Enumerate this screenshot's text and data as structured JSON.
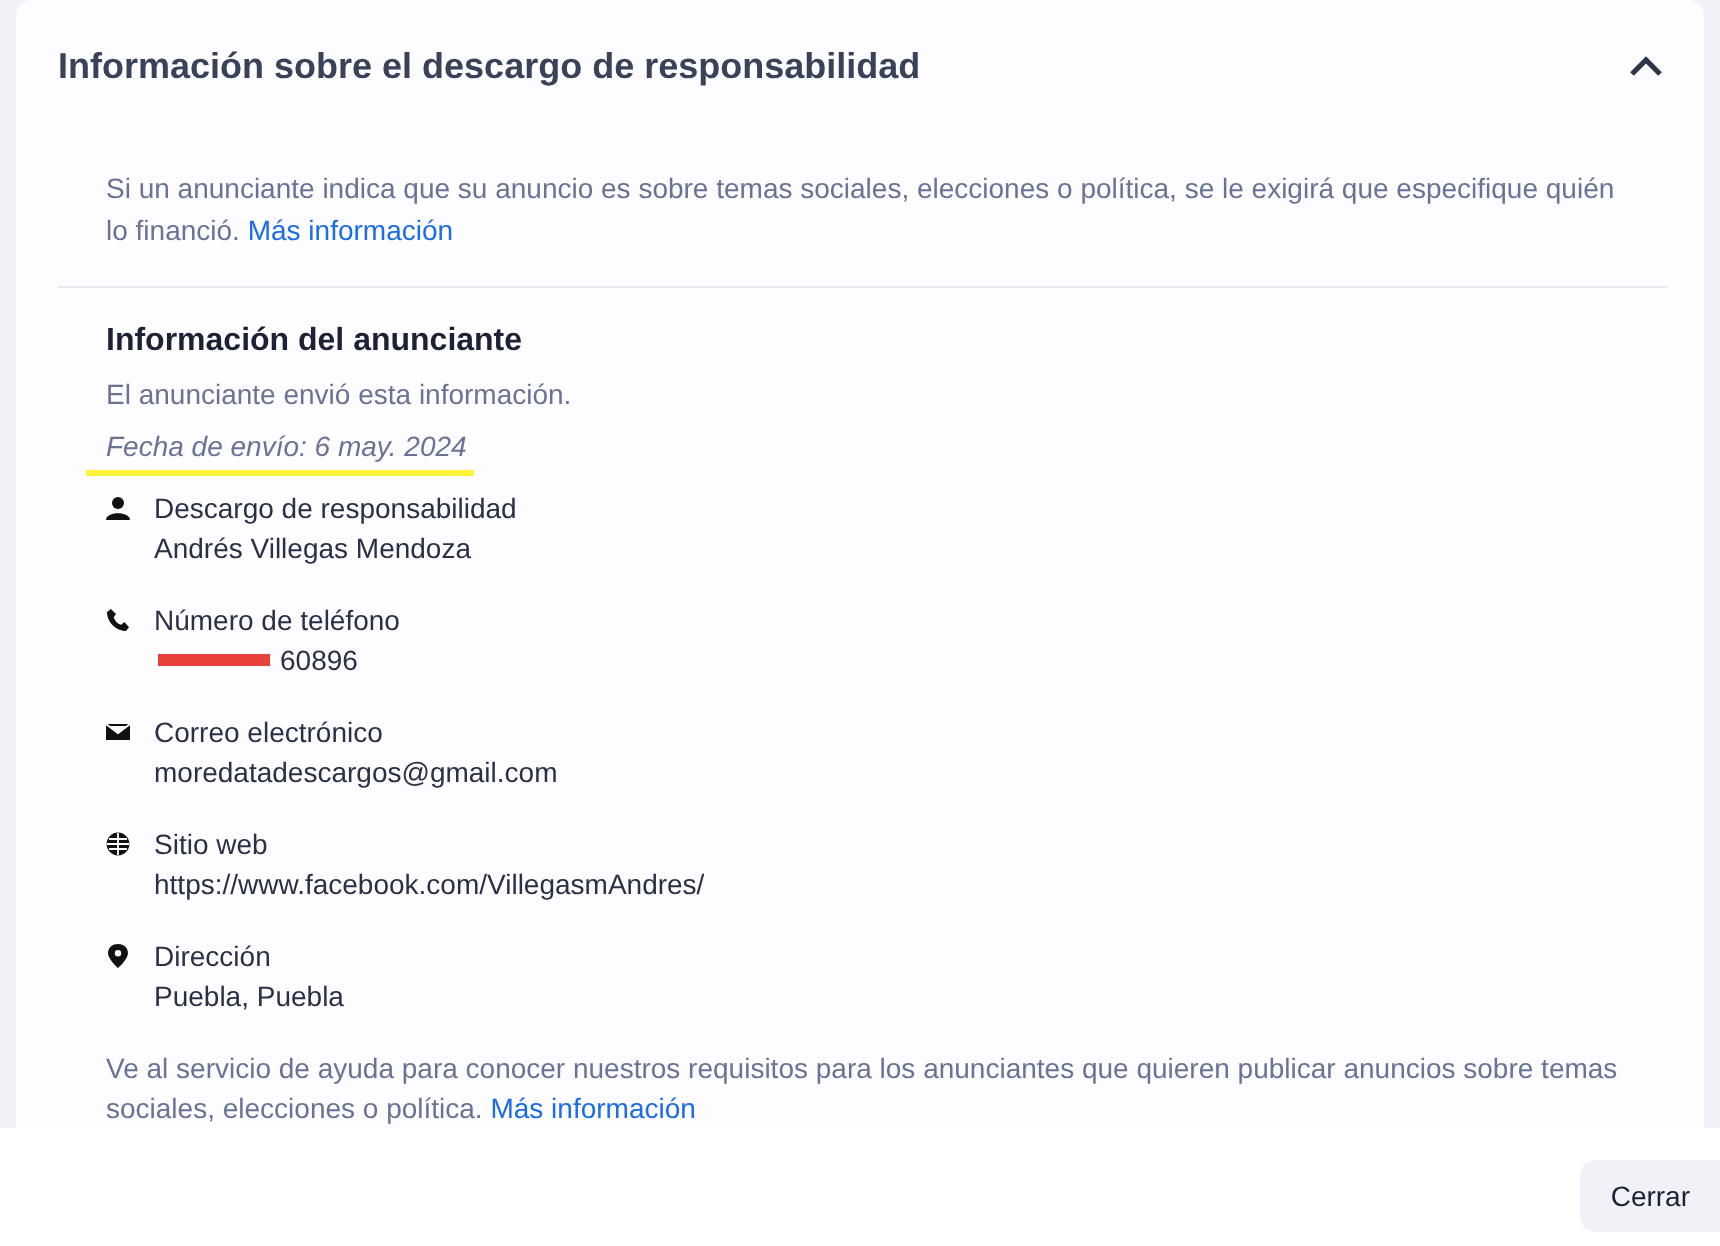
{
  "section": {
    "title": "Información sobre el descargo de responsabilidad",
    "expanded": true,
    "intro": "Si un anunciante indica que su anuncio es sobre temas sociales, elecciones o política, se le exigirá que especifique quién lo financió.",
    "intro_link": "Más información",
    "advertiser": {
      "heading": "Información del anunciante",
      "note": "El anunciante envió esta información.",
      "date": "Fecha de envío: 6 may. 2024",
      "date_highlighted": true,
      "fields": [
        {
          "kind": "person",
          "label": "Descargo de responsabilidad",
          "value": "Andrés Villegas Mendoza",
          "redacted": false
        },
        {
          "kind": "phone",
          "label": "Número de teléfono",
          "value": "60896",
          "redacted": true
        },
        {
          "kind": "email",
          "label": "Correo electrónico",
          "value": "moredatadescargos@gmail.com",
          "redacted": false
        },
        {
          "kind": "web",
          "label": "Sitio web",
          "value": "https://www.facebook.com/VillegasmAndres/",
          "redacted": false
        },
        {
          "kind": "location",
          "label": "Dirección",
          "value": "Puebla, Puebla",
          "redacted": false
        }
      ]
    },
    "footer_text": "Ve al servicio de ayuda para conocer nuestros requisitos para los anunciantes que quieren publicar anuncios sobre temas sociales, elecciones o política.",
    "footer_link": "Más información"
  },
  "buttons": [
    "Cerrar"
  ]
}
